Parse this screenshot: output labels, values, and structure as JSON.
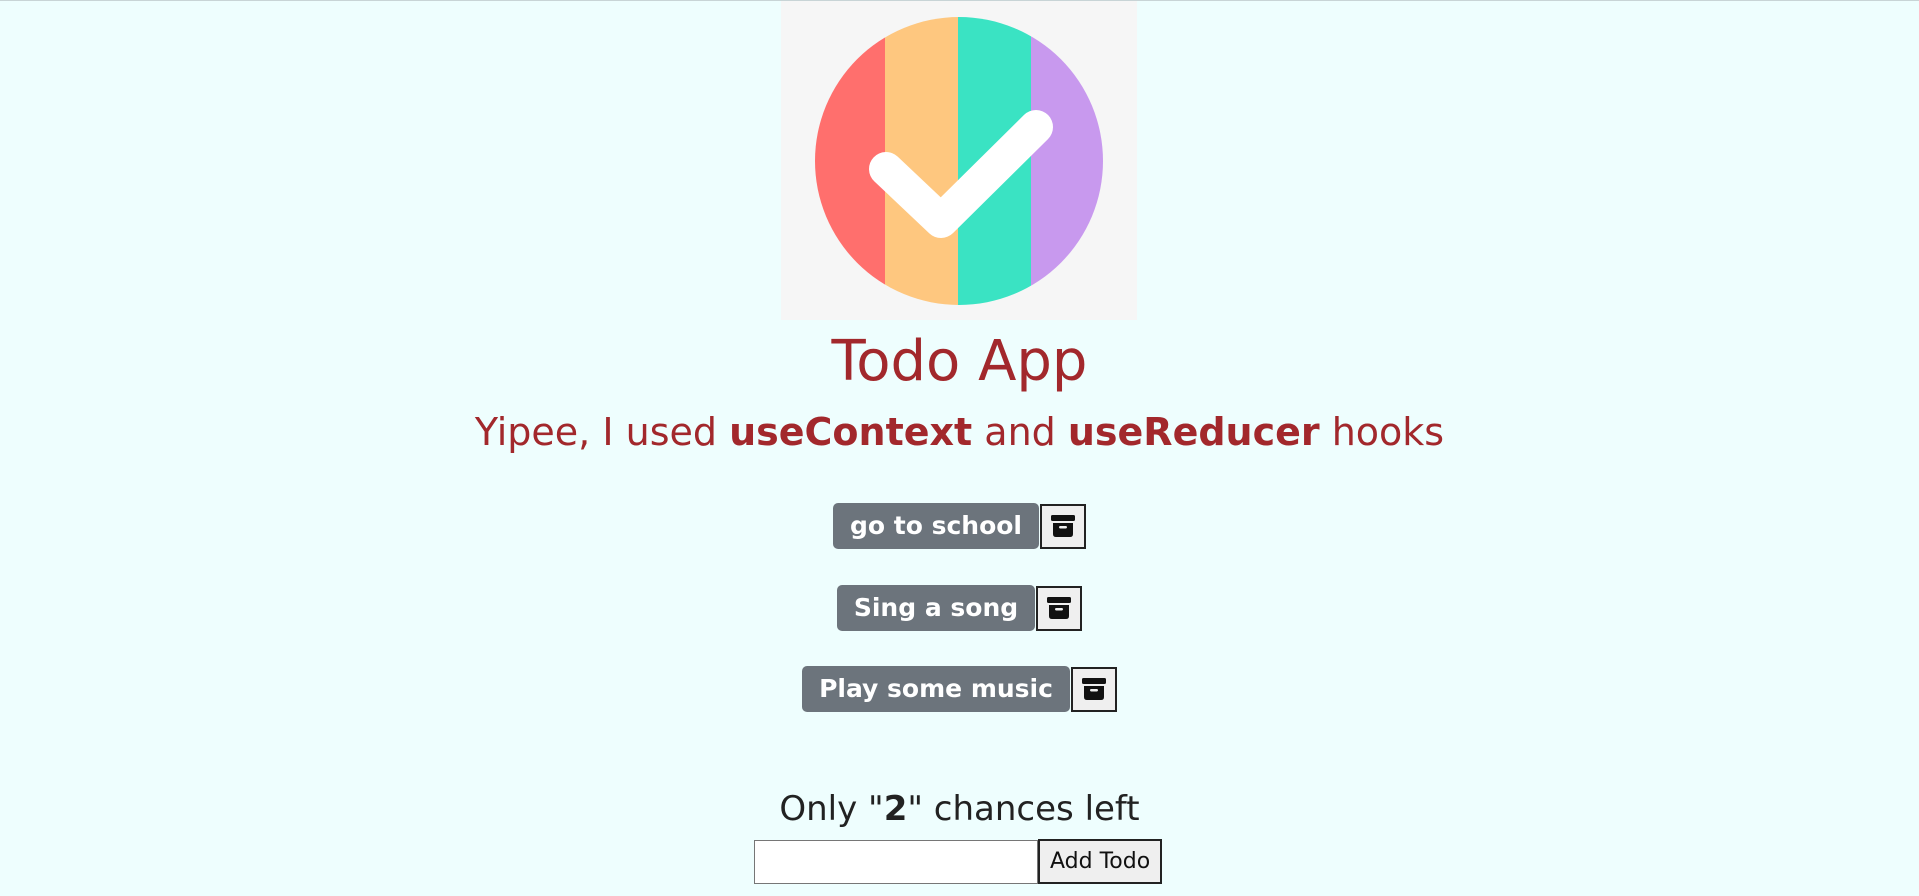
{
  "header": {
    "title": "Todo App",
    "subtitle_prefix": "Yipee, I used ",
    "hook_one": "useContext",
    "subtitle_middle": " and ",
    "hook_two": "useReducer",
    "subtitle_suffix": " hooks"
  },
  "logo": {
    "stripe_colors": [
      "#ff6f6d",
      "#fec77f",
      "#3ae3c3",
      "#c899ee"
    ],
    "check_color": "#ffffff",
    "background": "#f6f6f6"
  },
  "todos": [
    {
      "label": "go to school",
      "action_icon": "archive-icon"
    },
    {
      "label": "Sing a song",
      "action_icon": "archive-icon"
    },
    {
      "label": "Play some music",
      "action_icon": "archive-icon"
    }
  ],
  "footer": {
    "chances_prefix": "Only \"",
    "chances_count": "2",
    "chances_suffix": "\" chances left",
    "input_value": "",
    "input_placeholder": "",
    "add_button_label": "Add Todo"
  },
  "colors": {
    "page_background": "#eefefe",
    "title": "#a2282c",
    "todo_chip": "#6c747c"
  }
}
